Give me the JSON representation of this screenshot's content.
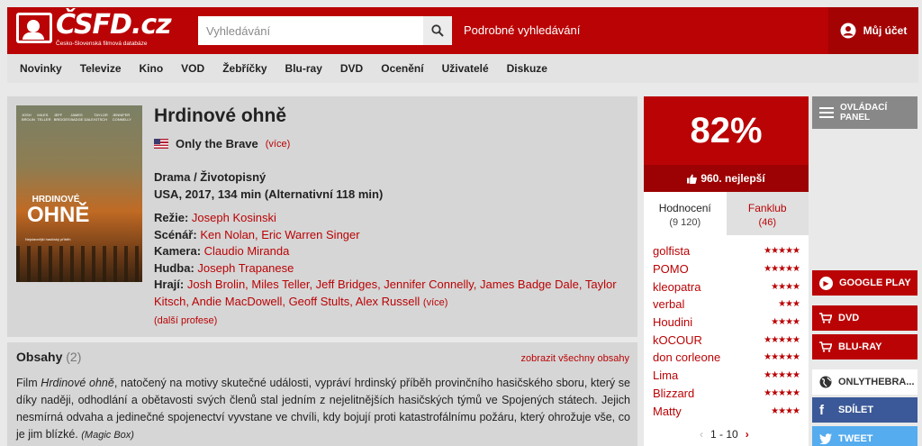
{
  "header": {
    "logo_text": "ČSFD.cz",
    "logo_subtitle": "Česko-Slovenská filmová databáze",
    "search_placeholder": "Vyhledávání",
    "advanced_search": "Podrobné vyhledávání",
    "account": "Můj účet"
  },
  "nav": [
    "Novinky",
    "Televize",
    "Kino",
    "VOD",
    "Žebříčky",
    "Blu-ray",
    "DVD",
    "Ocenění",
    "Uživatelé",
    "Diskuze"
  ],
  "film": {
    "title": "Hrdinové ohně",
    "original_title": "Only the Brave",
    "more": "(více)",
    "genre": "Drama / Životopisný",
    "origin": "USA, 2017, 134 min (Alternativní 118 min)",
    "poster": {
      "credits": [
        "JOSH BROLIN",
        "MILES TELLER",
        "JEFF BRIDGES",
        "JAMES BADGE DALE",
        "TAYLOR KITSCH",
        "JENNIFER CONNELLY"
      ],
      "title_line1": "HRDINOVÉ",
      "title_line2": "OHNĚ",
      "tagline": "Nejslavnější hasičský příběh"
    },
    "director_label": "Režie:",
    "director": "Joseph Kosinski",
    "writer_label": "Scénář:",
    "writers": "Ken Nolan, Eric Warren Singer",
    "camera_label": "Kamera:",
    "camera": "Claudio Miranda",
    "music_label": "Hudba:",
    "music": "Joseph Trapanese",
    "cast_label": "Hrají:",
    "cast": "Josh Brolin, Miles Teller, Jeff Bridges, Jennifer Connelly, James Badge Dale, Taylor Kitsch, Andie MacDowell, Geoff Stults, Alex Russell",
    "cast_more": "(více)",
    "more_creators": "(další profese)"
  },
  "plot": {
    "heading": "Obsahy",
    "count": "(2)",
    "show_all": "zobrazit všechny obsahy",
    "text_prefix": "Film ",
    "text_title": "Hrdinové ohně",
    "text_body": ", natočený na motivy skutečné události, vypráví hrdinský příběh provinčního hasičského sboru, který se díky naději, odhodlání a obětavosti svých členů stal jedním z nejelitnějších hasičských týmů ve Spojených státech. Jejich nesmírná odvaha a jedinečné spojenectví vyvstane ve chvíli, kdy bojují proti katastrofálnímu požáru, který ohrožuje vše, co je jim blízké.",
    "source": "(Magic Box)"
  },
  "rating": {
    "score": "82%",
    "rank": "960. nejlepší",
    "tab_ratings": "Hodnocení",
    "tab_ratings_count": "(9 120)",
    "tab_fanclub": "Fanklub",
    "tab_fanclub_count": "(46)",
    "users": [
      {
        "name": "golfista",
        "stars": "★★★★★"
      },
      {
        "name": "POMO",
        "stars": "★★★★★"
      },
      {
        "name": "kleopatra",
        "stars": "★★★★"
      },
      {
        "name": "verbal",
        "stars": "★★★"
      },
      {
        "name": "Houdini",
        "stars": "★★★★"
      },
      {
        "name": "kOCOUR",
        "stars": "★★★★★"
      },
      {
        "name": "don corleone",
        "stars": "★★★★★"
      },
      {
        "name": "Lima",
        "stars": "★★★★★"
      },
      {
        "name": "Blizzard",
        "stars": "★★★★★"
      },
      {
        "name": "Matty",
        "stars": "★★★★"
      }
    ],
    "pager": "1 - 10"
  },
  "side": {
    "panel": "OVLÁDACÍ PANEL",
    "google_play": "GOOGLE PLAY",
    "dvd": "DVD",
    "bluray": "BLU-RAY",
    "onlythebrave": "ONLYTHEBRA...",
    "share": "SDÍLET",
    "tweet": "TWEET"
  }
}
